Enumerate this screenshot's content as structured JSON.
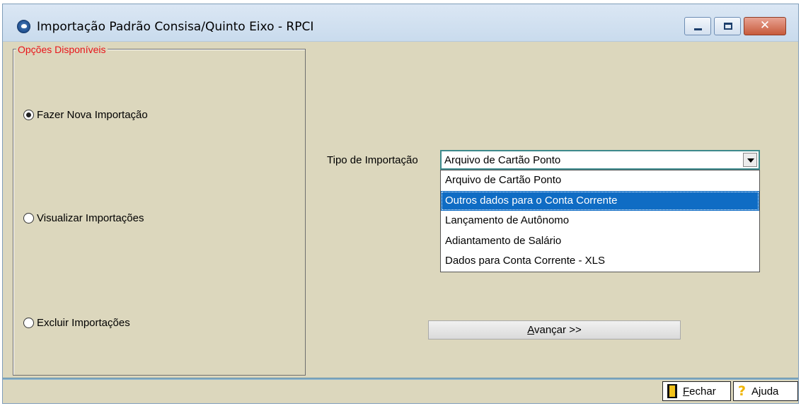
{
  "window": {
    "title": "Importação Padrão Consisa/Quinto Eixo - RPCI",
    "close_symbol": "✕"
  },
  "options_group": {
    "legend": "Opções Disponíveis",
    "options": [
      {
        "label": "Fazer Nova Importação",
        "selected": true
      },
      {
        "label": "Visualizar Importações",
        "selected": false
      },
      {
        "label": "Excluir Importações",
        "selected": false
      }
    ]
  },
  "import_type": {
    "label": "Tipo de Importação",
    "selected_value": "Arquivo de Cartão Ponto",
    "dropdown_open": true,
    "highlighted_index": 1,
    "options": [
      "Arquivo de Cartão Ponto",
      "Outros dados para o Conta Corrente",
      "Lançamento de Autônomo",
      "Adiantamento de Salário",
      "Dados para Conta Corrente - XLS"
    ]
  },
  "buttons": {
    "advance_accel": "A",
    "advance_rest": "vançar >>",
    "close_accel": "F",
    "close_rest": "echar",
    "help_icon": "?",
    "help_label": "Ajuda"
  },
  "colors": {
    "window_bg": "#dcd7bd",
    "legend": "#e8141a",
    "selection": "#0f6cc4",
    "combo_border": "#3c8a8c"
  },
  "icons": {
    "app": "app-logo-icon",
    "close": "door-exit-icon",
    "help": "question-mark-icon"
  }
}
